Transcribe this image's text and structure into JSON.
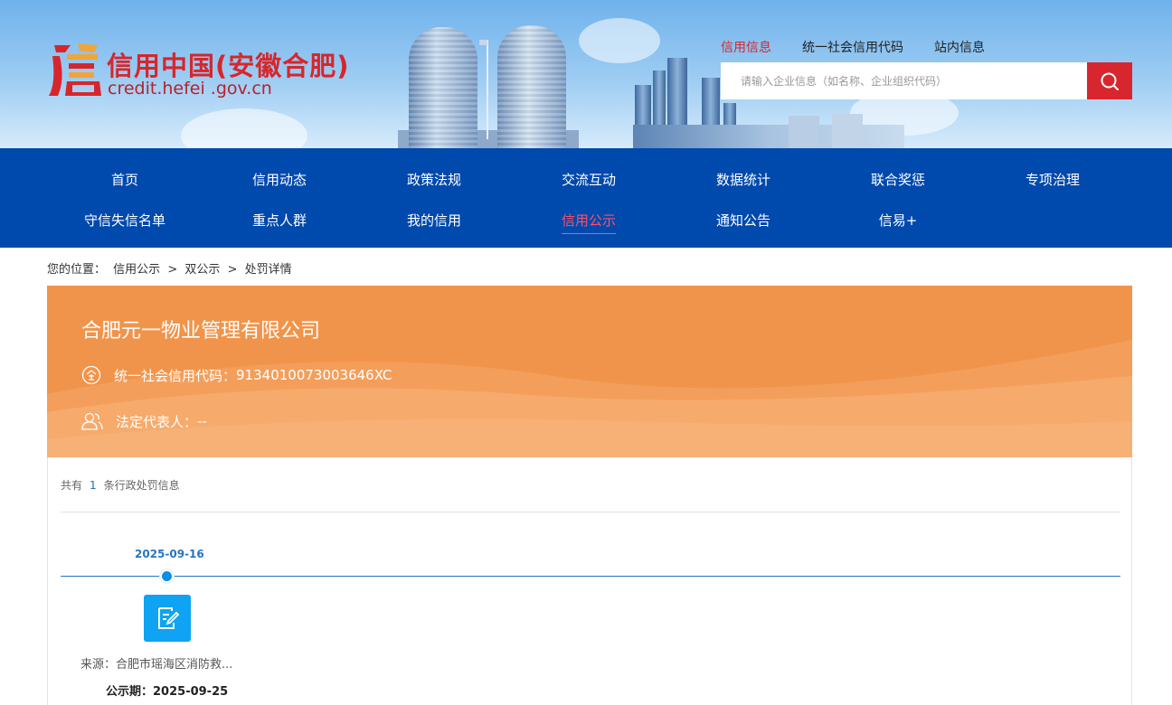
{
  "header": {
    "logo_title": "信用中国(安徽合肥)",
    "logo_sub": "credit.hefei .gov.cn",
    "top_links": [
      {
        "label": "信用信息",
        "active": true
      },
      {
        "label": "统一社会信用代码",
        "active": false
      },
      {
        "label": "站内信息",
        "active": false
      }
    ],
    "search": {
      "placeholder": "请输入企业信息（如名称、企业组织代码）",
      "value": ""
    },
    "search_icon": "search-icon"
  },
  "nav": {
    "row1": [
      "首页",
      "信用动态",
      "政策法规",
      "交流互动",
      "数据统计",
      "联合奖惩",
      "专项治理"
    ],
    "row2": [
      "守信失信名单",
      "重点人群",
      "我的信用",
      "信用公示",
      "通知公告",
      "信易+"
    ],
    "active": "信用公示",
    "active_color": "#ff5268",
    "bg_color": "#0049ad"
  },
  "breadcrumb": {
    "prefix": "您的位置：",
    "items": [
      "信用公示",
      "双公示",
      "处罚详情"
    ],
    "sep": ">"
  },
  "company": {
    "name": "合肥元一物业管理有限公司",
    "credit_code_label": "统一社会信用代码：",
    "credit_code": "9134010073003646XC",
    "legal_rep_label": "法定代表人：",
    "legal_rep": "--",
    "banner_color": "#f1944b"
  },
  "records": {
    "count_prefix": "共有",
    "count": "1",
    "count_suffix": "条行政处罚信息",
    "items": [
      {
        "date": "2025-09-16",
        "source_label": "来源：",
        "source": "合肥市瑶海区消防救...",
        "period_label": "公示期：",
        "period": "2025-09-25",
        "icon": "edit-document-icon"
      }
    ]
  }
}
